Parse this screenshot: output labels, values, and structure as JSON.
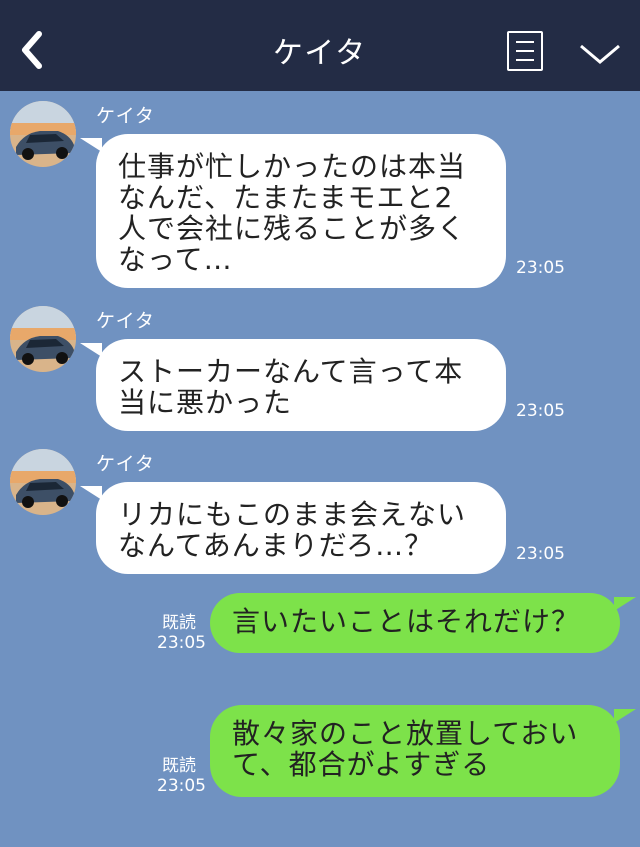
{
  "header": {
    "title": "ケイタ",
    "back_icon": "chevron-left-icon",
    "menu_icon": "list-icon",
    "more_icon": "chevron-down-icon"
  },
  "messages": [
    {
      "side": "in",
      "sender": "ケイタ",
      "text": "仕事が忙しかったのは本当\nなんだ、たまたまモエと2\n人で会社に残ることが多く\nなって…",
      "time": "23:05"
    },
    {
      "side": "in",
      "sender": "ケイタ",
      "text": "ストーカーなんて言って本\n当に悪かった",
      "time": "23:05"
    },
    {
      "side": "in",
      "sender": "ケイタ",
      "text": "リカにもこのまま会えない\nなんてあんまりだろ…？",
      "time": "23:05"
    },
    {
      "side": "out",
      "text": "言いたいことはそれだけ？",
      "read": "既読",
      "time": "23:05"
    },
    {
      "side": "out",
      "text": "散々家のこと放置しておい\nて、都合がよすぎる",
      "read": "既読",
      "time": "23:05"
    }
  ],
  "colors": {
    "header": "#232c45",
    "background": "#7092c1",
    "incoming": "#ffffff",
    "outgoing": "#7de24a"
  }
}
